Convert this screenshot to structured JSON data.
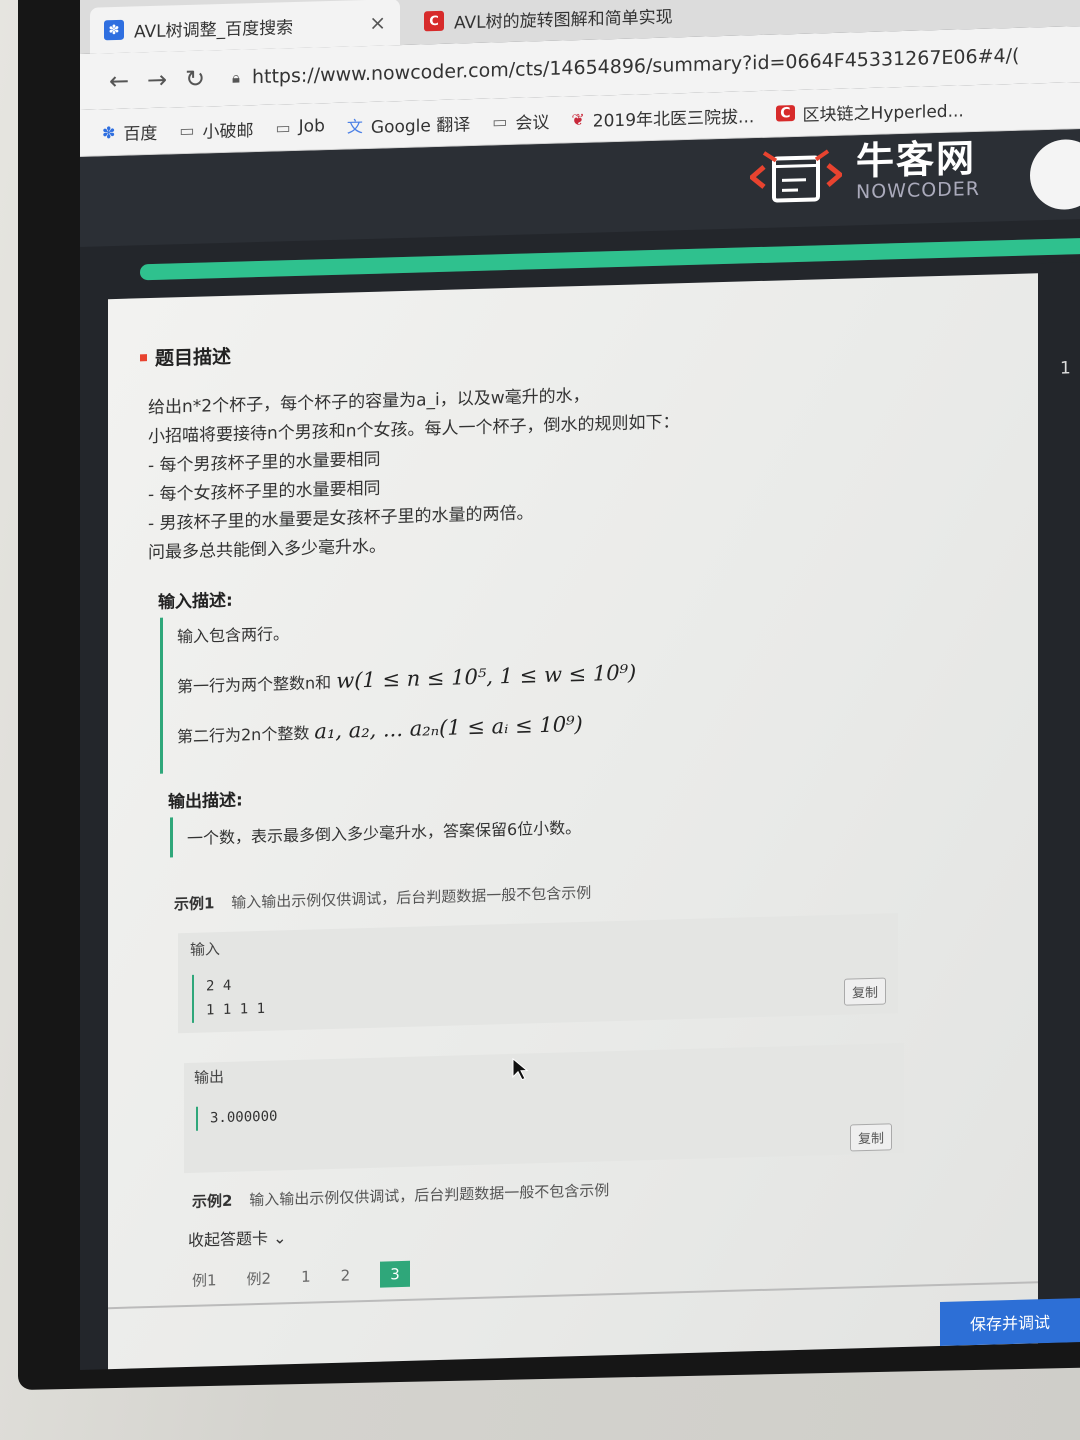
{
  "browser": {
    "tabs": [
      {
        "label": "AVL树调整_百度搜索",
        "icon": "baidu-paw-icon",
        "active": true
      },
      {
        "label": "AVL树的旋转图解和简单实现",
        "icon": "csdn-c-icon",
        "active": false
      }
    ],
    "tab_close": "×",
    "url": "https://www.nowcoder.com/cts/14654896/summary?id=0664F45331267E06#4/(",
    "bookmarks": [
      {
        "label": "百度",
        "icon": "baidu-paw-icon"
      },
      {
        "label": "小破邮",
        "icon": "folder-icon"
      },
      {
        "label": "Job",
        "icon": "folder-icon"
      },
      {
        "label": "Google 翻译",
        "icon": "google-translate-icon"
      },
      {
        "label": "会议",
        "icon": "folder-icon"
      },
      {
        "label": "2019年北医三院拔...",
        "icon": "bird-icon"
      },
      {
        "label": "区块链之Hyperled...",
        "icon": "csdn-c-icon"
      }
    ]
  },
  "site": {
    "logo_cn": "牛客网",
    "logo_en": "NOWCODER",
    "progress": 1.0,
    "side_number": "1",
    "save_button": "保存并调试"
  },
  "problem": {
    "section_title": "题目描述",
    "description": [
      "给出n*2个杯子，每个杯子的容量为a_i，以及w毫升的水，",
      "小招喵将要接待n个男孩和n个女孩。每人一个杯子，倒水的规则如下：",
      "- 每个男孩杯子里的水量要相同",
      "- 每个女孩杯子里的水量要相同",
      "- 男孩杯子里的水量要是女孩杯子里的水量的两倍。",
      "问最多总共能倒入多少毫升水。"
    ],
    "input_title": "输入描述:",
    "input_lines": [
      "输入包含两行。",
      "第一行为两个整数n和",
      "第二行为2n个整数"
    ],
    "input_math": [
      "",
      "w(1 ≤ n ≤ 10⁵, 1 ≤ w ≤ 10⁹)",
      "a₁, a₂, ... a₂ₙ(1 ≤ aᵢ ≤ 10⁹)"
    ],
    "output_title": "输出描述:",
    "output_text": "一个数，表示最多倒入多少毫升水，答案保留6位小数。",
    "example1_title": "示例1",
    "example_note": "输入输出示例仅供调试，后台判题数据一般不包含示例",
    "input_label": "输入",
    "example1_input": [
      "2 4",
      "1 1 1 1"
    ],
    "output_label": "输出",
    "example1_output": "3.000000",
    "copy_label": "复制",
    "example2_title": "示例2",
    "collapse_label": "收起答题卡 ⌄",
    "pager": [
      "例1",
      "例2",
      "1",
      "2",
      "3"
    ],
    "pager_current": "3"
  }
}
